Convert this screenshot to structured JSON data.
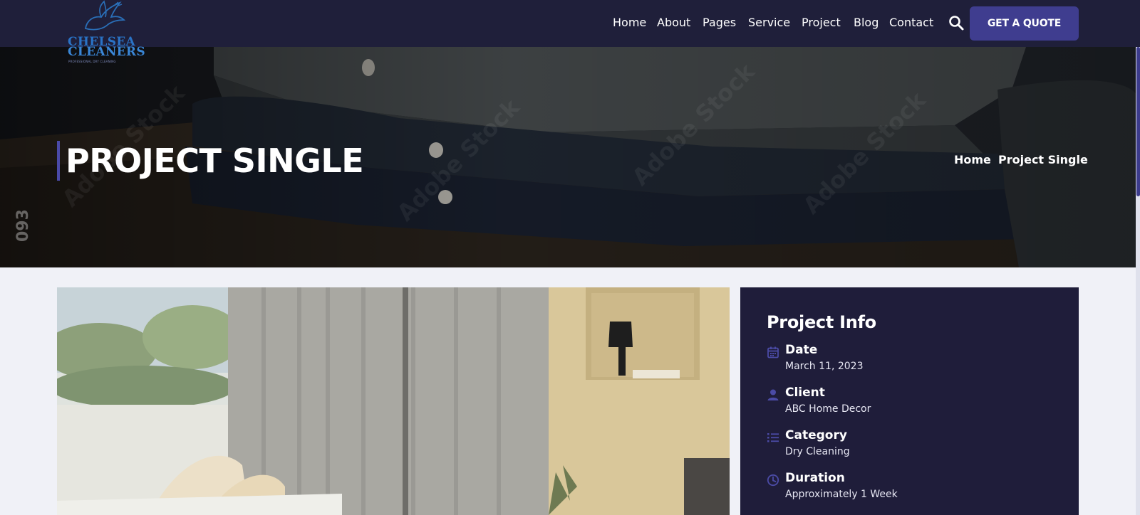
{
  "brand": {
    "logo_line1": "CHELSEA",
    "logo_line2": "CLEANERS",
    "logo_tagline": "PROFESSIONAL DRY CLEANING",
    "logo_icon": "dove-icon"
  },
  "nav": {
    "items": [
      {
        "label": "Home"
      },
      {
        "label": "About"
      },
      {
        "label": "Pages"
      },
      {
        "label": "Service"
      },
      {
        "label": "Project"
      },
      {
        "label": "Blog"
      },
      {
        "label": "Contact"
      }
    ],
    "search_icon": "search-icon",
    "cta_label": "GET A QUOTE"
  },
  "hero": {
    "title": "PROJECT SINGLE",
    "breadcrumb": [
      {
        "label": "Home"
      },
      {
        "label": "Project Single"
      }
    ],
    "image_watermark": "Adobe Stock",
    "image_side_number": "093"
  },
  "project_info": {
    "title": "Project Info",
    "items": [
      {
        "icon": "calendar-icon",
        "label": "Date",
        "value": "March 11, 2023"
      },
      {
        "icon": "user-icon",
        "label": "Client",
        "value": "ABC Home Decor"
      },
      {
        "icon": "list-icon",
        "label": "Category",
        "value": "Dry Cleaning"
      },
      {
        "icon": "clock-icon",
        "label": "Duration",
        "value": "Approximately 1 Week"
      }
    ]
  },
  "colors": {
    "navbar_bg": "#1f1f3a",
    "accent": "#3f3d8f",
    "card_bg": "#1f1d3a",
    "page_bg": "#f0f1f7"
  }
}
